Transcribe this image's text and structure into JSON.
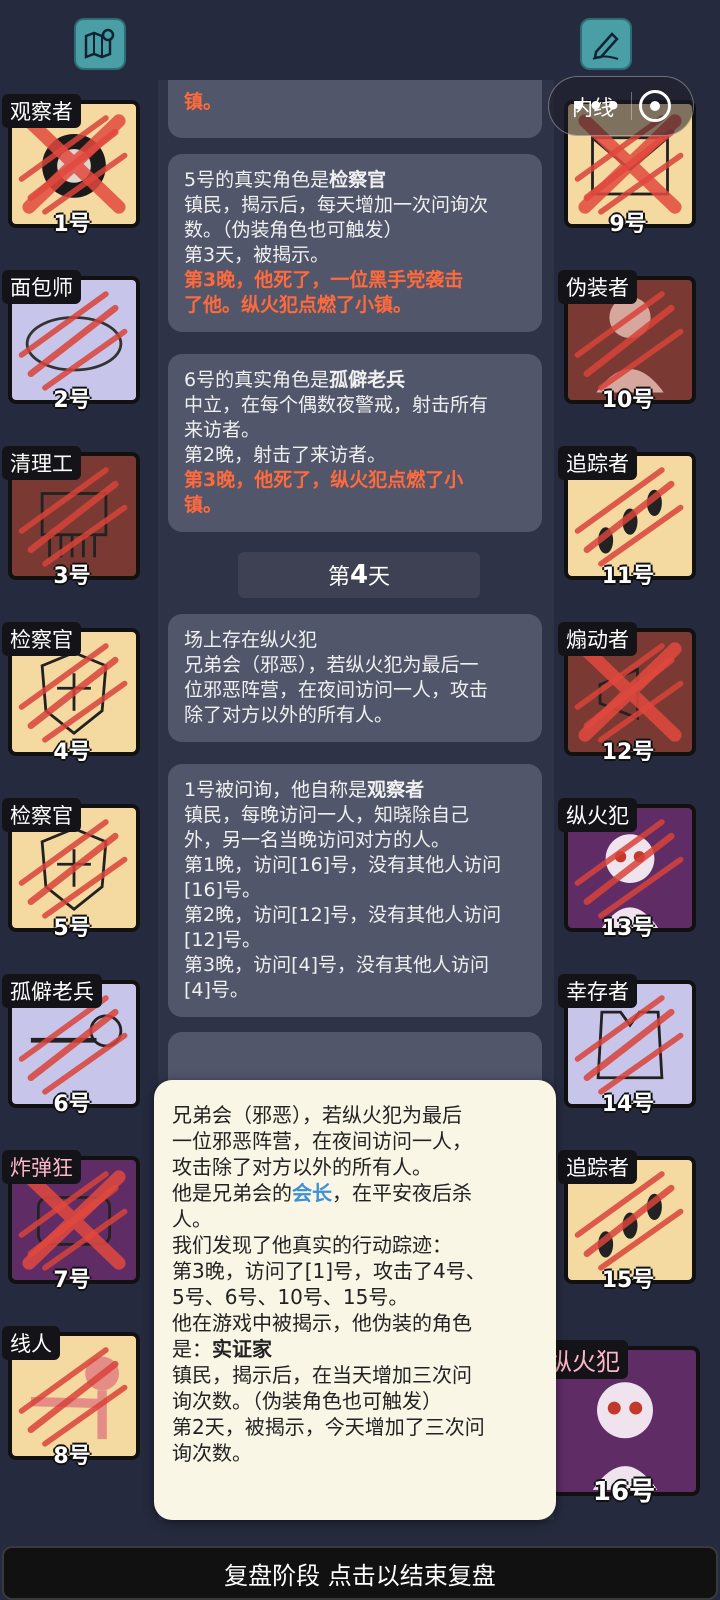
{
  "top_left_icon": "map-icon",
  "top_right_icon": "edit-note-icon",
  "capsule": {
    "label": "内线",
    "menu_icon": "more-dots-icon",
    "close_icon": "target-icon"
  },
  "players_left": [
    {
      "role": "观察者",
      "num": "1号",
      "bg": "beige",
      "icon": "pot-icon"
    },
    {
      "role": "面包师",
      "num": "2号",
      "bg": "lav",
      "icon": "bread-icon"
    },
    {
      "role": "清理工",
      "num": "3号",
      "bg": "red",
      "icon": "shredder-icon"
    },
    {
      "role": "检察官",
      "num": "4号",
      "bg": "beige",
      "icon": "justice-badge-icon"
    },
    {
      "role": "检察官",
      "num": "5号",
      "bg": "beige",
      "icon": "justice-badge-icon"
    },
    {
      "role": "孤僻老兵",
      "num": "6号",
      "bg": "lav",
      "icon": "veteran-icon"
    },
    {
      "role": "炸弹狂",
      "num": "7号",
      "bg": "purple",
      "icon": "bomb-icon"
    },
    {
      "role": "线人",
      "num": "8号",
      "bg": "beige",
      "icon": "informant-icon"
    }
  ],
  "players_right": [
    {
      "role": "",
      "num": "9号",
      "bg": "beige",
      "icon": "envelope-icon"
    },
    {
      "role": "伪装者",
      "num": "10号",
      "bg": "red",
      "icon": "disguiser-icon"
    },
    {
      "role": "追踪者",
      "num": "11号",
      "bg": "beige",
      "icon": "footprints-icon"
    },
    {
      "role": "煽动者",
      "num": "12号",
      "bg": "red",
      "icon": "megaphone-icon"
    },
    {
      "role": "纵火犯",
      "num": "13号",
      "bg": "purple",
      "icon": "arsonist-icon"
    },
    {
      "role": "幸存者",
      "num": "14号",
      "bg": "lav",
      "icon": "vest-icon"
    },
    {
      "role": "追踪者",
      "num": "15号",
      "bg": "beige",
      "icon": "footprints-icon"
    },
    {
      "role": "纵火犯",
      "num": "16号",
      "bg": "purple",
      "icon": "arsonist-icon"
    }
  ],
  "feed": {
    "msg0_tail": "镇。",
    "msg1": {
      "l1a": "5号的真实角色是",
      "l1b": "检察官",
      "l2": "镇民，揭示后，每天增加一次问询次",
      "l3": "数。（伪装角色也可触发）",
      "l4": "第3天，被揭示。",
      "l5": "第3晚，他死了，一位黑手党袭击",
      "l6": "了他。纵火犯点燃了小镇。"
    },
    "msg2": {
      "l1a": "6号的真实角色是",
      "l1b": "孤僻老兵",
      "l2": "中立，在每个偶数夜警戒，射击所有",
      "l3": "来访者。",
      "l4": "第2晚，射击了来访者。",
      "l5": "第3晚，他死了，纵火犯点燃了小",
      "l6": "镇。"
    },
    "day": {
      "prefix": "第",
      "number": "4",
      "suffix": "天"
    },
    "msg3": {
      "l1": "场上存在纵火犯",
      "l2": "兄弟会（邪恶），若纵火犯为最后一",
      "l3": "位邪恶阵营，在夜间访问一人，攻击",
      "l4": "除了对方以外的所有人。"
    },
    "msg4": {
      "l1a": "1号被问询，他自称是",
      "l1b": "观察者",
      "l2": "镇民，每晚访问一人，知晓除自己",
      "l3": "外，另一名当晚访问对方的人。",
      "l4": "第1晚，访问[16]号，没有其他人访问",
      "l5": "[16]号。",
      "l6": "第2晚，访问[12]号，没有其他人访问",
      "l7": "[12]号。",
      "l8": "第3晚，访问[4]号，没有其他人访问",
      "l9": "[4]号。"
    }
  },
  "popup": {
    "l1": "兄弟会（邪恶），若纵火犯为最后",
    "l2": "一位邪恶阵营，在夜间访问一人，",
    "l3": "攻击除了对方以外的所有人。",
    "l4a": "他是兄弟会的",
    "l4b": "会长",
    "l4c": "，在平安夜后杀",
    "l5": "人。",
    "l6": "我们发现了他真实的行动踪迹：",
    "l7": "第3晚，访问了[1]号，攻击了4号、",
    "l8": "5号、6号、10号、15号。",
    "l9": "他在游戏中被揭示，他伪装的角色",
    "l10a": "是：",
    "l10b": "实证家",
    "l11": "镇民，揭示后，在当天增加三次问",
    "l12": "询次数。（伪装角色也可触发）",
    "l13": "第2天，被揭示，今天增加了三次问",
    "l14": "询次数。"
  },
  "bottom_bar": "复盘阶段 点击以结束复盘"
}
